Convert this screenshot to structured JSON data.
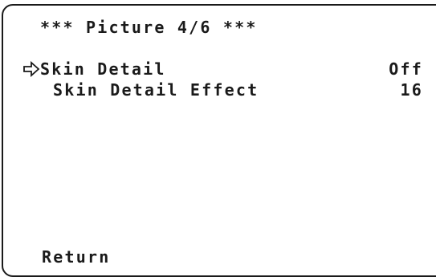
{
  "menu": {
    "title": "*** Picture 4/6 ***",
    "items": [
      {
        "label": "Skin Detail",
        "value": "Off",
        "selected": true
      },
      {
        "label": "Skin Detail Effect",
        "value": "16",
        "selected": false
      }
    ],
    "return_label": "Return",
    "cursor_icon": "hollow-right-arrow-icon"
  }
}
